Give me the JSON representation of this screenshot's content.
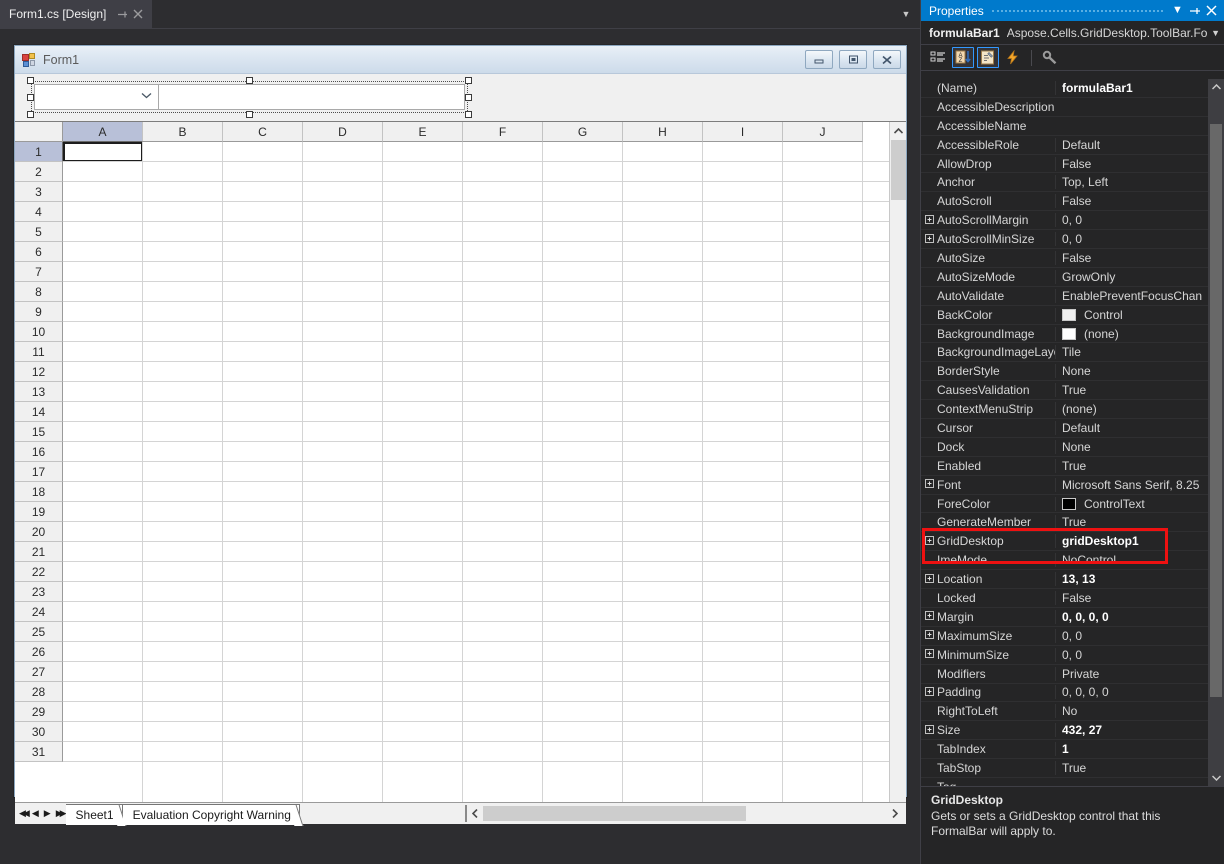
{
  "editor": {
    "tab_label": "Form1.cs [Design]",
    "pin_icon": "pin-icon",
    "close_icon": "close-icon",
    "overflow_icon": "chevron-down-icon"
  },
  "form": {
    "title": "Form1",
    "minimize_label": "–",
    "maximize_label": "□",
    "close_label": "✕",
    "namebox_value": "",
    "namebox_chevron": "chevron-down-icon",
    "formula_value": ""
  },
  "grid": {
    "columns": [
      "A",
      "B",
      "C",
      "D",
      "E",
      "F",
      "G",
      "H",
      "I",
      "J"
    ],
    "selected_column": "A",
    "rows": [
      "1",
      "2",
      "3",
      "4",
      "5",
      "6",
      "7",
      "8",
      "9",
      "10",
      "11",
      "12",
      "13",
      "14",
      "15",
      "16",
      "17",
      "18",
      "19",
      "20",
      "21",
      "22",
      "23",
      "24",
      "25",
      "26",
      "27",
      "28",
      "29",
      "30",
      "31"
    ],
    "selected_row": "1",
    "active_cell": "A1",
    "active_cell_value": "",
    "scroll_up_icon": "caret-up-icon",
    "scroll_down_icon": "caret-down-icon",
    "hscroll_left_icon": "caret-left-icon",
    "hscroll_right_icon": "caret-right-icon"
  },
  "sheetbar": {
    "nav_first": "◀◀",
    "nav_prev": "◀",
    "nav_next": "▶",
    "nav_last": "▶▶",
    "tabs": [
      {
        "label": "Sheet1",
        "active": true
      },
      {
        "label": "Evaluation Copyright Warning",
        "active": false
      }
    ]
  },
  "properties": {
    "panel_title": "Properties",
    "title_dropdown_icon": "chevron-down-icon",
    "title_pin_icon": "pin-icon",
    "title_close_icon": "close-icon",
    "object_name": "formulaBar1",
    "object_type": "Aspose.Cells.GridDesktop.ToolBar.For",
    "object_dropdown_icon": "chevron-down-icon",
    "toolbar": [
      {
        "name": "categorized-icon",
        "label": "Categorized",
        "active": false
      },
      {
        "name": "alphabetical-icon",
        "label": "Alphabetical",
        "active": true
      },
      {
        "name": "properties-icon",
        "label": "Properties",
        "active": true
      },
      {
        "name": "events-icon",
        "label": "Events",
        "active": false
      },
      {
        "name": "property-pages-icon",
        "label": "Property Pages",
        "active": false
      }
    ],
    "rows": [
      {
        "name": "(Name)",
        "value": "formulaBar1",
        "expandable": false,
        "bold": true
      },
      {
        "name": "AccessibleDescription",
        "value": "",
        "expandable": false,
        "bold": false
      },
      {
        "name": "AccessibleName",
        "value": "",
        "expandable": false,
        "bold": false
      },
      {
        "name": "AccessibleRole",
        "value": "Default",
        "expandable": false,
        "bold": false
      },
      {
        "name": "AllowDrop",
        "value": "False",
        "expandable": false,
        "bold": false
      },
      {
        "name": "Anchor",
        "value": "Top, Left",
        "expandable": false,
        "bold": false
      },
      {
        "name": "AutoScroll",
        "value": "False",
        "expandable": false,
        "bold": false
      },
      {
        "name": "AutoScrollMargin",
        "value": "0, 0",
        "expandable": true,
        "bold": false
      },
      {
        "name": "AutoScrollMinSize",
        "value": "0, 0",
        "expandable": true,
        "bold": false
      },
      {
        "name": "AutoSize",
        "value": "False",
        "expandable": false,
        "bold": false
      },
      {
        "name": "AutoSizeMode",
        "value": "GrowOnly",
        "expandable": false,
        "bold": false
      },
      {
        "name": "AutoValidate",
        "value": "EnablePreventFocusChan",
        "expandable": false,
        "bold": false
      },
      {
        "name": "BackColor",
        "value": "Control",
        "expandable": false,
        "bold": false,
        "swatch": "#f0f0f0"
      },
      {
        "name": "BackgroundImage",
        "value": "(none)",
        "expandable": false,
        "bold": false,
        "swatch": "#ffffff"
      },
      {
        "name": "BackgroundImageLayo",
        "value": "Tile",
        "expandable": false,
        "bold": false
      },
      {
        "name": "BorderStyle",
        "value": "None",
        "expandable": false,
        "bold": false
      },
      {
        "name": "CausesValidation",
        "value": "True",
        "expandable": false,
        "bold": false
      },
      {
        "name": "ContextMenuStrip",
        "value": "(none)",
        "expandable": false,
        "bold": false
      },
      {
        "name": "Cursor",
        "value": "Default",
        "expandable": false,
        "bold": false
      },
      {
        "name": "Dock",
        "value": "None",
        "expandable": false,
        "bold": false
      },
      {
        "name": "Enabled",
        "value": "True",
        "expandable": false,
        "bold": false
      },
      {
        "name": "Font",
        "value": "Microsoft Sans Serif, 8.25",
        "expandable": true,
        "bold": false
      },
      {
        "name": "ForeColor",
        "value": "ControlText",
        "expandable": false,
        "bold": false,
        "swatch": "#000000"
      },
      {
        "name": "GenerateMember",
        "value": "True",
        "expandable": false,
        "bold": false
      },
      {
        "name": "GridDesktop",
        "value": "gridDesktop1",
        "expandable": true,
        "bold": true
      },
      {
        "name": "ImeMode",
        "value": "NoControl",
        "expandable": false,
        "bold": false
      },
      {
        "name": "Location",
        "value": "13, 13",
        "expandable": true,
        "bold": true
      },
      {
        "name": "Locked",
        "value": "False",
        "expandable": false,
        "bold": false
      },
      {
        "name": "Margin",
        "value": "0, 0, 0, 0",
        "expandable": true,
        "bold": true
      },
      {
        "name": "MaximumSize",
        "value": "0, 0",
        "expandable": true,
        "bold": false
      },
      {
        "name": "MinimumSize",
        "value": "0, 0",
        "expandable": true,
        "bold": false
      },
      {
        "name": "Modifiers",
        "value": "Private",
        "expandable": false,
        "bold": false
      },
      {
        "name": "Padding",
        "value": "0, 0, 0, 0",
        "expandable": true,
        "bold": false
      },
      {
        "name": "RightToLeft",
        "value": "No",
        "expandable": false,
        "bold": false
      },
      {
        "name": "Size",
        "value": "432, 27",
        "expandable": true,
        "bold": true
      },
      {
        "name": "TabIndex",
        "value": "1",
        "expandable": false,
        "bold": true
      },
      {
        "name": "TabStop",
        "value": "True",
        "expandable": false,
        "bold": false
      },
      {
        "name": "Tag",
        "value": "",
        "expandable": false,
        "bold": false
      }
    ],
    "description_title": "GridDesktop",
    "description_body": "Gets or sets a GridDesktop control that this FormalBar will apply to.",
    "scroll_up_icon": "caret-up-icon",
    "scroll_down_icon": "caret-down-icon"
  },
  "annotation": {
    "color": "#ee1111",
    "target": "GridDesktop"
  }
}
